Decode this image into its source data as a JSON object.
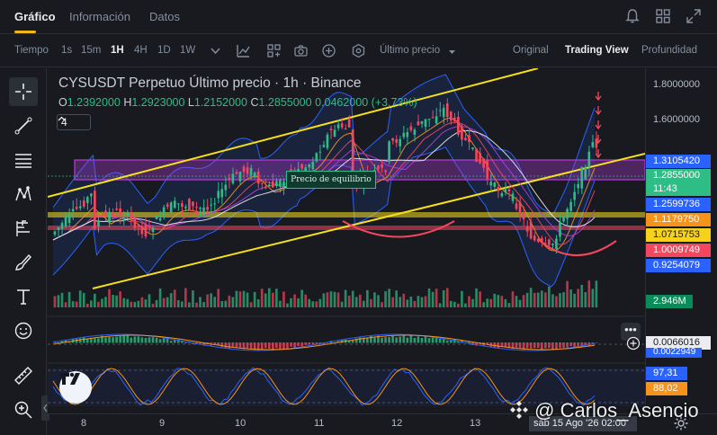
{
  "tabs": [
    {
      "label": "Gráfico"
    },
    {
      "label": "Información"
    },
    {
      "label": "Datos"
    }
  ],
  "toolbar": {
    "time_label": "Tiempo",
    "intervals": [
      "1s",
      "15m",
      "1H",
      "4H",
      "1D",
      "1W"
    ],
    "active_interval": "1H",
    "price_type": "Último precio",
    "views": [
      "Original",
      "Trading View",
      "Profundidad"
    ],
    "active_view": "Trading View"
  },
  "chart": {
    "title": "CYSUSDT Perpetuo Último precio · 1h · Binance",
    "ohlc": {
      "o_label": "O",
      "o": "1.2392000",
      "h_label": "H",
      "h": "1.2923000",
      "l_label": "L",
      "l": "1.2152000",
      "c_label": "C",
      "c": "1.2855000",
      "change": "0.0462000 (+3.73%)"
    },
    "indicator_count": "4",
    "equilibrium_label": "Precio de equilibrio"
  },
  "price_scale": {
    "ticks": [
      "1.8000000",
      "1.6000000"
    ],
    "tags": [
      {
        "value": "1.3105420",
        "color": "#2962ff"
      },
      {
        "value": "1.2855000",
        "color": "#2ebd85"
      },
      {
        "value": "11:43",
        "color": "#2ebd85"
      },
      {
        "value": "1.2599736",
        "color": "#2962ff"
      },
      {
        "value": "1.1179750",
        "color": "#f7931a"
      },
      {
        "value": "1.0715753",
        "color": "#f7d21a"
      },
      {
        "value": "1.0009749",
        "color": "#f6465d"
      },
      {
        "value": "0.9254079",
        "color": "#2962ff"
      }
    ],
    "volume_tag": "2.946M",
    "macd_tags": [
      {
        "value": "0.0066016"
      },
      {
        "value": "0.0022949"
      }
    ],
    "stoch_tags": [
      {
        "value": "97,31",
        "color": "#2962ff"
      },
      {
        "value": "88,02",
        "color": "#f7931a"
      }
    ]
  },
  "time_axis": {
    "labels": [
      "8",
      "9",
      "10",
      "11",
      "12",
      "13"
    ],
    "crosshair": "sáb 15 Ago '26   02:00"
  },
  "watermark": "@ Carlos_Asencio",
  "colors": {
    "up": "#2ebd85",
    "down": "#f6465d",
    "channel": "#f7e01a",
    "bollinger": "#2962ff",
    "zone": "#b43ed8"
  },
  "icons": [
    "bell-icon",
    "grid-icon",
    "expand-icon",
    "crosshair-icon",
    "trendline-icon",
    "horizontal-lines-icon",
    "pattern-icon",
    "fib-icon",
    "brush-icon",
    "text-icon",
    "emoji-icon",
    "ruler-icon",
    "zoom-icon"
  ]
}
